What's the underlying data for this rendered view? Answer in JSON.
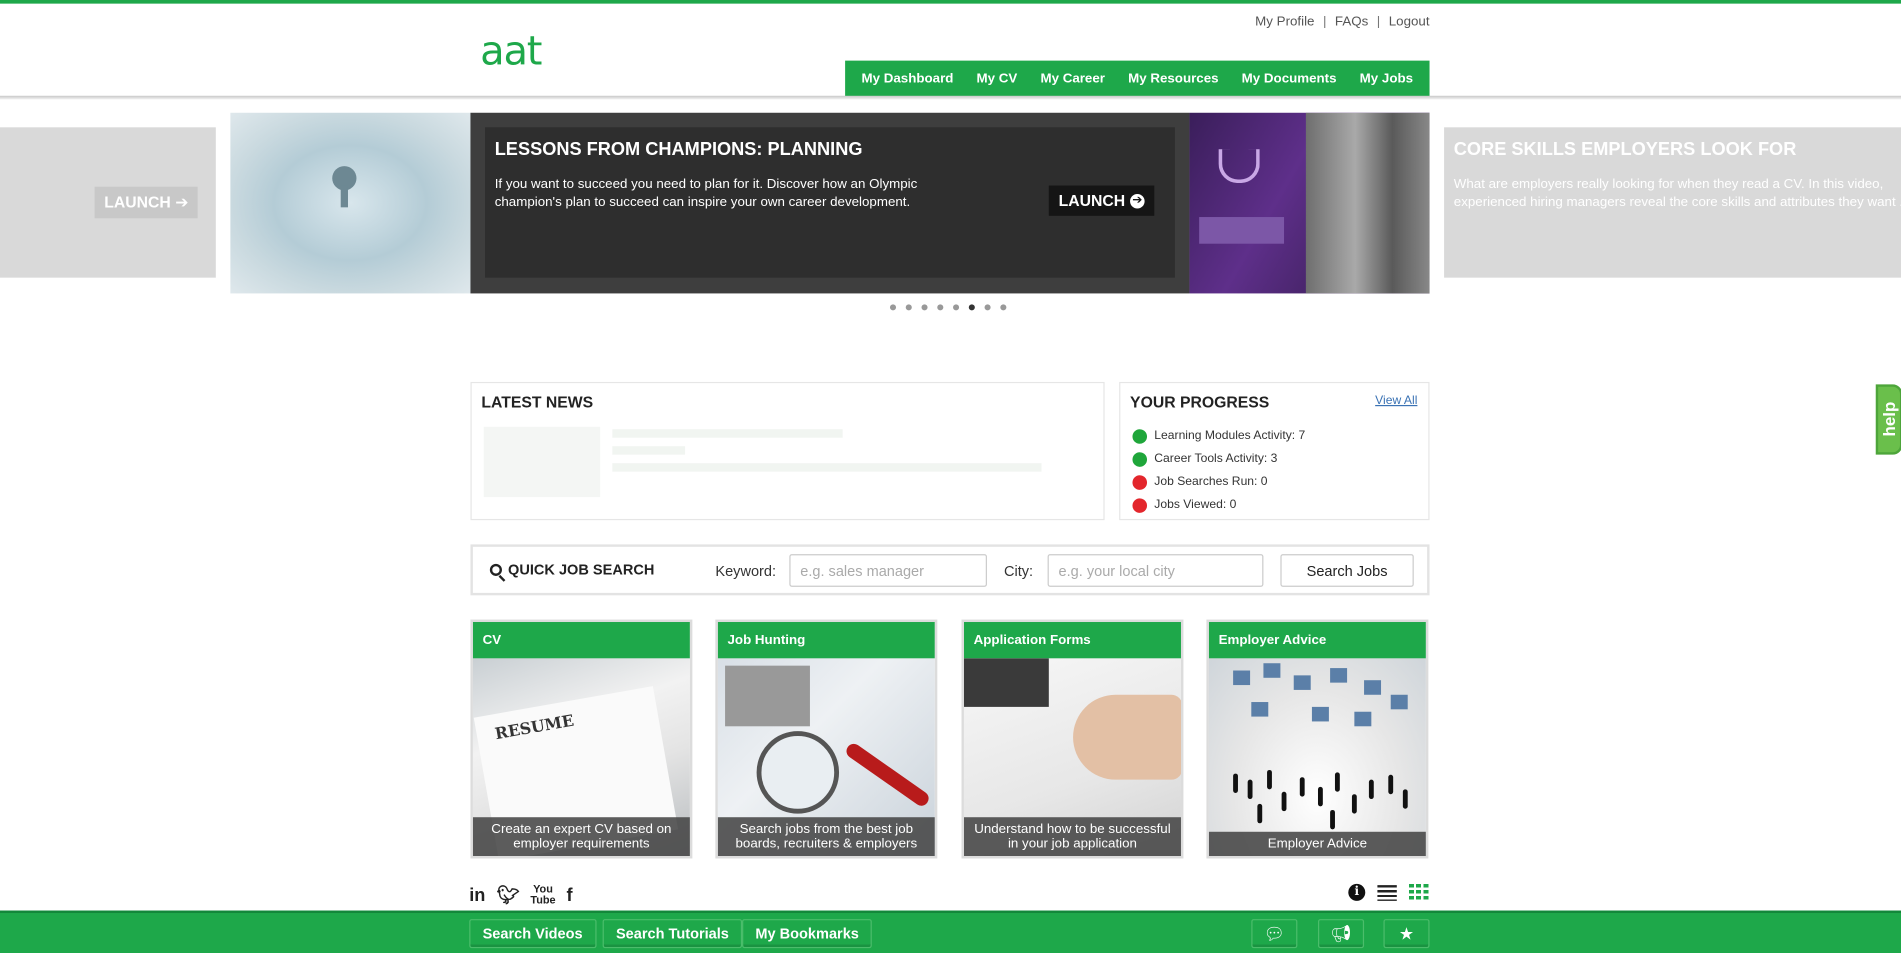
{
  "header": {
    "logo": "aat",
    "utility_links": [
      "My Profile",
      "FAQs",
      "Logout"
    ],
    "nav": [
      "My Dashboard",
      "My CV",
      "My Career",
      "My Resources",
      "My Documents",
      "My Jobs"
    ]
  },
  "carousel": {
    "prev_launch": "LAUNCH",
    "current": {
      "title": "LESSONS FROM CHAMPIONS: PLANNING",
      "description": "If you want to succeed you need to plan for it. Discover how an Olympic champion's plan to succeed can inspire your own career development.",
      "launch": "LAUNCH"
    },
    "next": {
      "title": "CORE SKILLS EMPLOYERS LOOK FOR",
      "description": "What are employers really looking for when they read a CV. In this video, experienced hiring managers reveal the core skills and attributes they want ..."
    },
    "dots_count": 8,
    "active_dot": 6
  },
  "news": {
    "title": "LATEST NEWS"
  },
  "progress": {
    "title": "YOUR PROGRESS",
    "view_all": "View All",
    "items": [
      {
        "label": "Learning Modules Activity: 7",
        "status": "green"
      },
      {
        "label": "Career Tools Activity: 3",
        "status": "green"
      },
      {
        "label": "Job Searches Run: 0",
        "status": "red"
      },
      {
        "label": "Jobs Viewed: 0",
        "status": "red"
      }
    ]
  },
  "quick_search": {
    "title": "QUICK JOB SEARCH",
    "keyword_label": "Keyword:",
    "keyword_placeholder": "e.g. sales manager",
    "city_label": "City:",
    "city_placeholder": "e.g. your local city",
    "button": "Search Jobs"
  },
  "tiles": [
    {
      "title": "CV",
      "caption": "Create an expert CV based on employer requirements"
    },
    {
      "title": "Job Hunting",
      "caption": "Search jobs from the best job boards, recruiters & employers"
    },
    {
      "title": "Application Forms",
      "caption": "Understand how to be successful in your job application"
    },
    {
      "title": "Employer Advice",
      "caption": "Employer Advice"
    }
  ],
  "social": [
    "linkedin-icon",
    "twitter-icon",
    "youtube-icon",
    "facebook-icon"
  ],
  "bottom_bar": {
    "buttons": [
      "Search Videos",
      "Search Tutorials",
      "My Bookmarks"
    ],
    "icons": [
      "chat-icon",
      "megaphone-icon",
      "star-icon"
    ]
  },
  "help_tab": "help",
  "colors": {
    "brand_green": "#1ea84a",
    "status_green": "#1fa63a",
    "status_red": "#e3262c",
    "link_blue": "#3a72b4"
  }
}
